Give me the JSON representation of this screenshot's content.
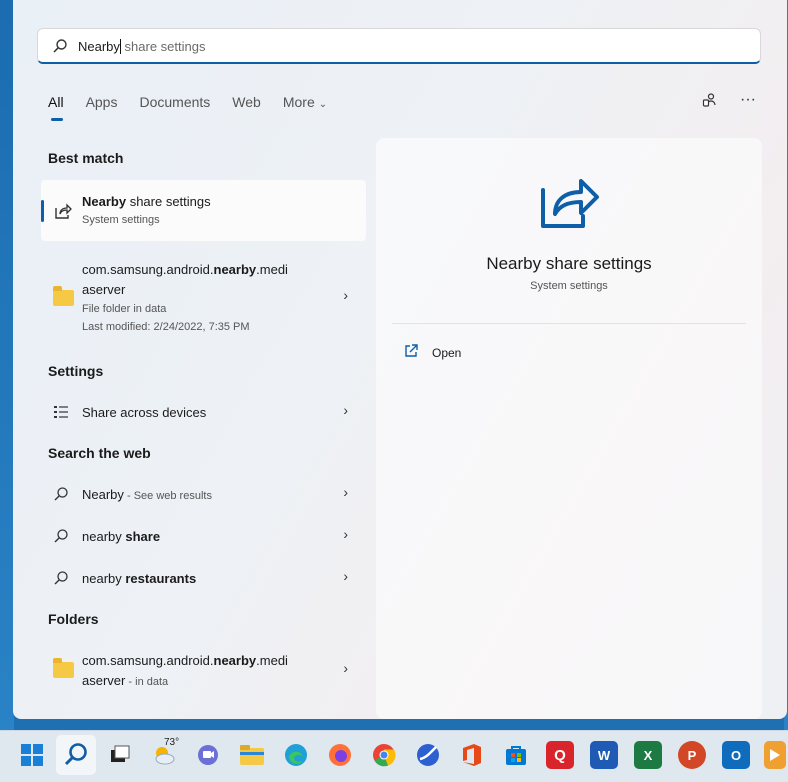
{
  "search": {
    "typed": "Nearby",
    "suggestion": " share settings"
  },
  "tabs": [
    {
      "label": "All"
    },
    {
      "label": "Apps"
    },
    {
      "label": "Documents"
    },
    {
      "label": "Web"
    },
    {
      "label": "More"
    }
  ],
  "sections": {
    "best_match": "Best match",
    "settings": "Settings",
    "search_web": "Search the web",
    "folders": "Folders"
  },
  "best_match": {
    "bold": "Nearby",
    "rest": " share settings",
    "sub": "System settings"
  },
  "folder_result": {
    "line1_pre": "com.samsung.android.",
    "line1_bold": "nearby",
    "line1_post": ".medi",
    "line2": "aserver",
    "line3": "File folder in data",
    "line4": "Last modified: 2/24/2022, 7:35 PM"
  },
  "settings_item": {
    "label": "Share across devices"
  },
  "web_results": [
    {
      "pre": "",
      "bold": "Nearby",
      "extra": " - See web results",
      "post": ""
    },
    {
      "pre": "nearby ",
      "bold": "share",
      "extra": "",
      "post": ""
    },
    {
      "pre": "nearby ",
      "bold": "restaurants",
      "extra": "",
      "post": ""
    }
  ],
  "folder_item": {
    "line1_pre": "com.samsung.android.",
    "line1_bold": "nearby",
    "line1_post": ".medi",
    "line2": "aserver",
    "line2_extra": " - in data"
  },
  "preview": {
    "title": "Nearby share settings",
    "sub": "System settings",
    "open": "Open"
  },
  "taskbar": {
    "weather": "73°"
  },
  "colors": {
    "accent": "#0e5ea8",
    "folder": "#f6c945"
  }
}
